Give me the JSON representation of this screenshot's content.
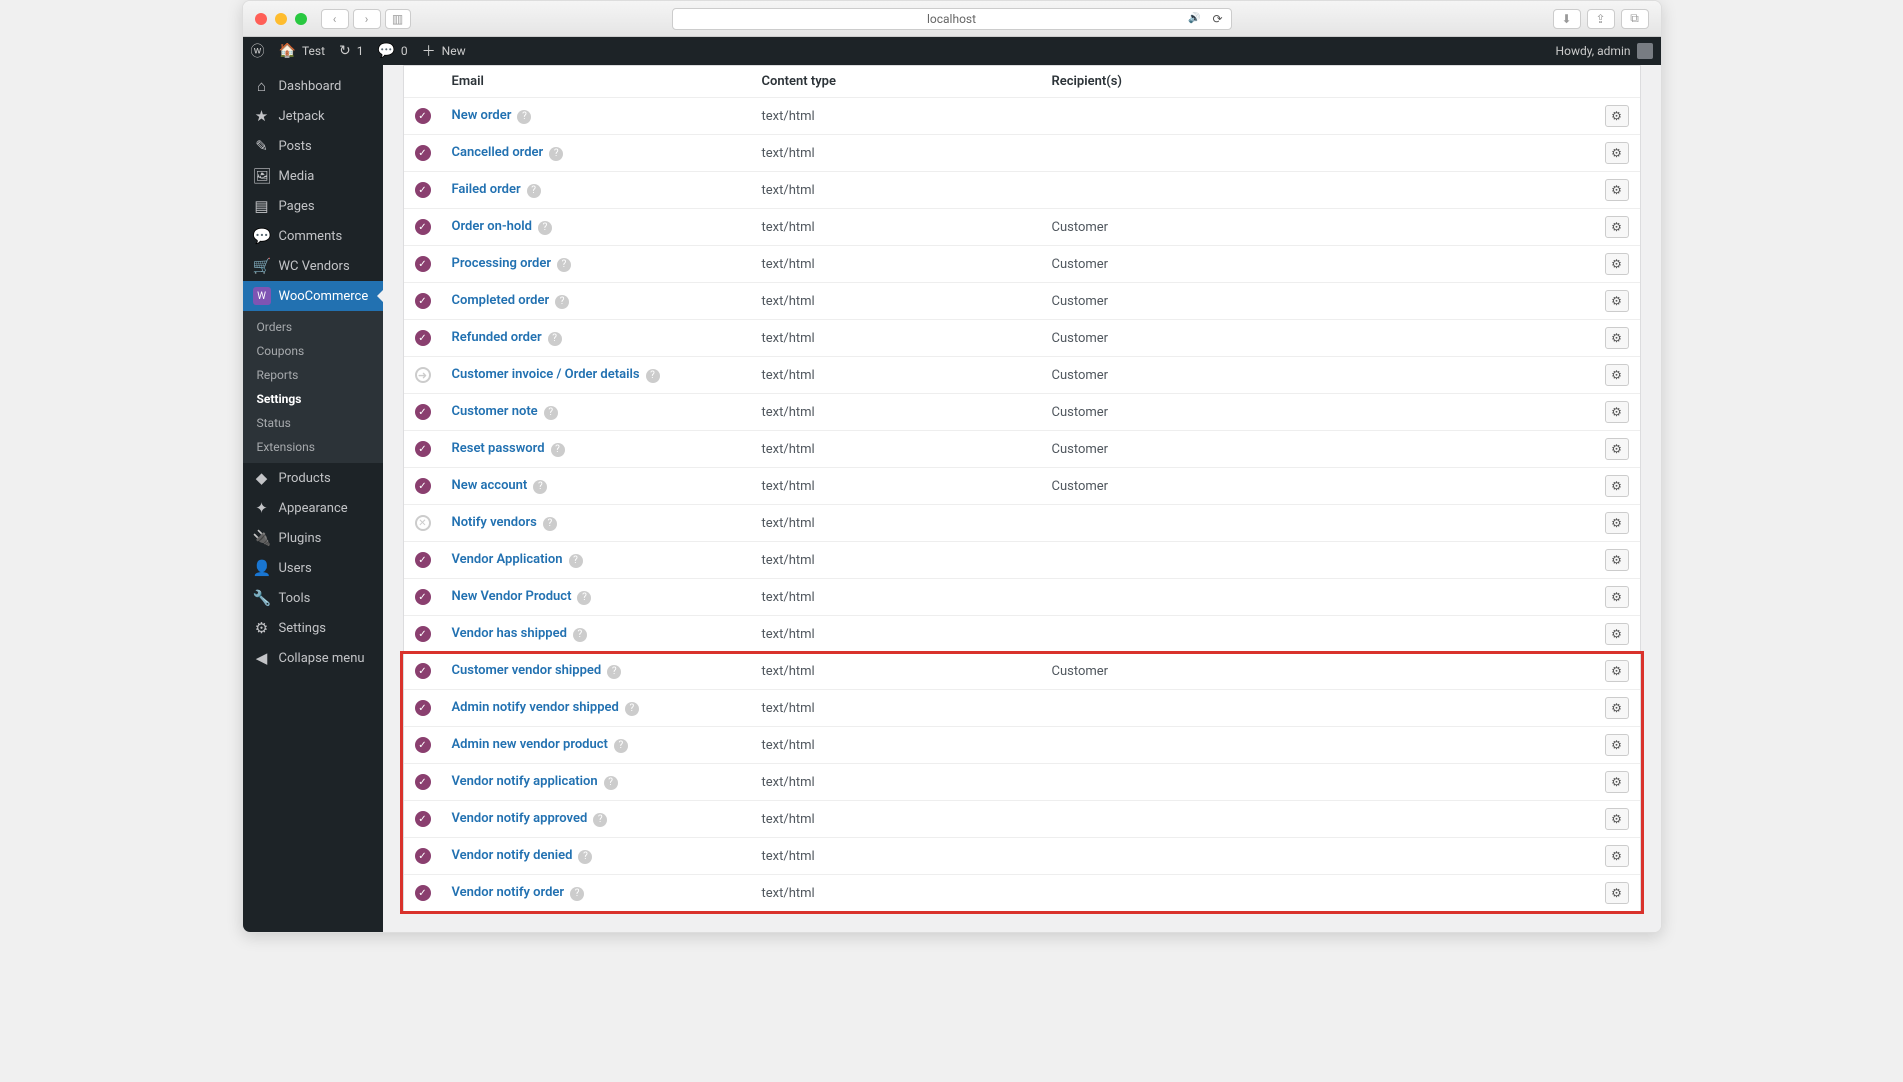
{
  "browser": {
    "url": "localhost"
  },
  "wpbar": {
    "site": "Test",
    "updates": "1",
    "comments": "0",
    "new": "New",
    "howdy": "Howdy, admin"
  },
  "sidebar": {
    "items": [
      {
        "icon": "⌂",
        "label": "Dashboard"
      },
      {
        "icon": "★",
        "label": "Jetpack"
      },
      {
        "icon": "✎",
        "label": "Posts"
      },
      {
        "icon": "🖼",
        "label": "Media"
      },
      {
        "icon": "▤",
        "label": "Pages"
      },
      {
        "icon": "💬",
        "label": "Comments"
      },
      {
        "icon": "🛒",
        "label": "WC Vendors"
      }
    ],
    "wc_label": "WooCommerce",
    "submenu": [
      {
        "label": "Orders"
      },
      {
        "label": "Coupons"
      },
      {
        "label": "Reports"
      },
      {
        "label": "Settings",
        "current": true
      },
      {
        "label": "Status"
      },
      {
        "label": "Extensions"
      }
    ],
    "bottom": [
      {
        "icon": "◆",
        "label": "Products"
      },
      {
        "icon": "✦",
        "label": "Appearance"
      },
      {
        "icon": "🔌",
        "label": "Plugins"
      },
      {
        "icon": "👤",
        "label": "Users"
      },
      {
        "icon": "🔧",
        "label": "Tools"
      },
      {
        "icon": "⚙",
        "label": "Settings"
      },
      {
        "icon": "◀",
        "label": "Collapse menu"
      }
    ]
  },
  "table": {
    "headers": {
      "email": "Email",
      "content": "Content type",
      "recipients": "Recipient(s)"
    },
    "rows": [
      {
        "status": "on",
        "name": "New order",
        "help": true,
        "content": "text/html",
        "recip": ""
      },
      {
        "status": "on",
        "name": "Cancelled order",
        "help": true,
        "content": "text/html",
        "recip": ""
      },
      {
        "status": "on",
        "name": "Failed order",
        "help": true,
        "content": "text/html",
        "recip": ""
      },
      {
        "status": "on",
        "name": "Order on-hold",
        "help": true,
        "content": "text/html",
        "recip": "Customer"
      },
      {
        "status": "on",
        "name": "Processing order",
        "help": true,
        "content": "text/html",
        "recip": "Customer"
      },
      {
        "status": "on",
        "name": "Completed order",
        "help": true,
        "content": "text/html",
        "recip": "Customer"
      },
      {
        "status": "on",
        "name": "Refunded order",
        "help": true,
        "content": "text/html",
        "recip": "Customer"
      },
      {
        "status": "arrow",
        "name": "Customer invoice / Order details",
        "help": true,
        "content": "text/html",
        "recip": "Customer"
      },
      {
        "status": "on",
        "name": "Customer note",
        "help": true,
        "content": "text/html",
        "recip": "Customer"
      },
      {
        "status": "on",
        "name": "Reset password",
        "help": true,
        "content": "text/html",
        "recip": "Customer"
      },
      {
        "status": "on",
        "name": "New account",
        "help": true,
        "content": "text/html",
        "recip": "Customer"
      },
      {
        "status": "off",
        "name": "Notify vendors",
        "help": true,
        "content": "text/html",
        "recip": ""
      },
      {
        "status": "on",
        "name": "Vendor Application",
        "help": true,
        "content": "text/html",
        "recip": ""
      },
      {
        "status": "on",
        "name": "New Vendor Product",
        "help": true,
        "content": "text/html",
        "recip": ""
      },
      {
        "status": "on",
        "name": "Vendor has shipped",
        "help": true,
        "content": "text/html",
        "recip": ""
      },
      {
        "status": "on",
        "name": "Customer vendor shipped",
        "help": true,
        "content": "text/html",
        "recip": "Customer",
        "hl_start": true
      },
      {
        "status": "on",
        "name": "Admin notify vendor shipped",
        "help": true,
        "content": "text/html",
        "recip": ""
      },
      {
        "status": "on",
        "name": "Admin new vendor product",
        "help": true,
        "content": "text/html",
        "recip": ""
      },
      {
        "status": "on",
        "name": "Vendor notify application",
        "help": true,
        "content": "text/html",
        "recip": ""
      },
      {
        "status": "on",
        "name": "Vendor notify approved",
        "help": true,
        "content": "text/html",
        "recip": ""
      },
      {
        "status": "on",
        "name": "Vendor notify denied",
        "help": true,
        "content": "text/html",
        "recip": ""
      },
      {
        "status": "on",
        "name": "Vendor notify order",
        "help": true,
        "content": "text/html",
        "recip": "",
        "hl_end": true
      }
    ]
  }
}
